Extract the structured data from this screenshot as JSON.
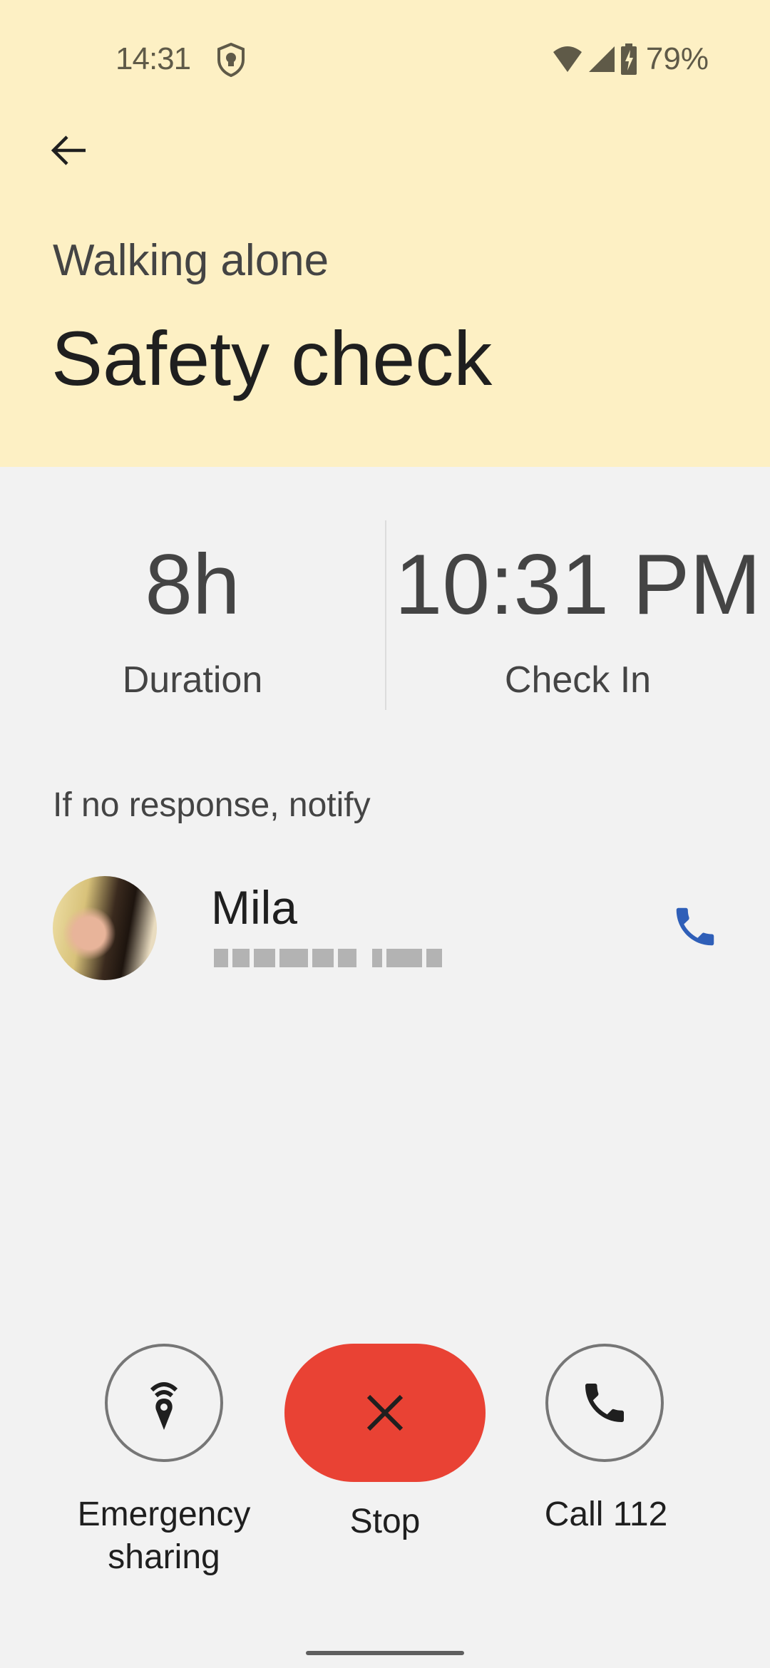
{
  "status_bar": {
    "time": "14:31",
    "battery_percent": "79%",
    "icons": [
      "shield-skull-icon",
      "wifi-icon",
      "signal-icon",
      "battery-charging-icon"
    ]
  },
  "header": {
    "back_icon": "arrow-back-icon",
    "subtitle": "Walking alone",
    "title": "Safety check",
    "background_color": "#fdf0c4"
  },
  "stats": [
    {
      "value": "8h",
      "label": "Duration"
    },
    {
      "value": "10:31 PM",
      "label": "Check In"
    }
  ],
  "notify": {
    "label": "If no response, notify",
    "contacts": [
      {
        "name": "Mila",
        "phone": "[redacted]",
        "call_icon": "phone-icon"
      }
    ]
  },
  "actions": [
    {
      "label": "Emergency sharing",
      "icon": "location-broadcast-icon"
    },
    {
      "label": "Stop",
      "icon": "close-icon",
      "color": "#e94234"
    },
    {
      "label": "Call 112",
      "icon": "phone-icon"
    }
  ],
  "accent_blue": "#2f5fb8"
}
